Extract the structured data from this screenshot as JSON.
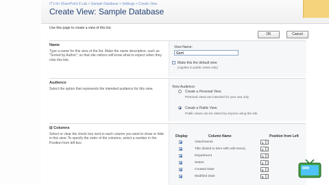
{
  "header": {
    "breadcrumb": "IT's for SharePoint 3 Lab > Sample Database > Settings > Create View",
    "title": "Create View: Sample Database"
  },
  "intro": "Use this page to create a view of this list.",
  "buttons": {
    "ok": "OK",
    "cancel": "Cancel"
  },
  "name_section": {
    "heading": "Name",
    "description": "Type a name for this view of the list. Make the name descriptive, such as \"Sorted by Author\", so that site visitors will know what to expect when they click this link.",
    "field_label": "View Name:",
    "field_value": "Gerri",
    "default_checkbox_label": "Make this the default view",
    "default_checkbox_note": "(Applies to public views only)",
    "default_checked": false
  },
  "audience_section": {
    "heading": "Audience",
    "description": "Select the option that represents the intended audience for this view.",
    "field_label": "View Audience:",
    "options": [
      {
        "label": "Create a Personal View",
        "note": "Personal views are intended for your use only.",
        "selected": false
      },
      {
        "label": "Create a Public View",
        "note": "Public views can be visited by anyone using the site.",
        "selected": true
      }
    ]
  },
  "columns_section": {
    "heading": "⊟ Columns",
    "description": "Select or clear the check box next to each column you want to show or hide in this view. To specify the order of the columns, select a number in the Position from left box.",
    "description_bold": "Position from left",
    "headers": {
      "display": "Display",
      "column_name": "Column Name",
      "position": "Position from Left"
    },
    "rows": [
      {
        "name": "Attachments",
        "checked": true,
        "position": "1"
      },
      {
        "name": "Title (linked to item with edit menu)",
        "checked": true,
        "position": "2"
      },
      {
        "name": "Department",
        "checked": true,
        "position": "3"
      },
      {
        "name": "Status",
        "checked": true,
        "position": "4"
      },
      {
        "name": "Created Date",
        "checked": true,
        "position": "5"
      },
      {
        "name": "Modified Date",
        "checked": true,
        "position": "6"
      }
    ]
  },
  "colors": {
    "title": "#1f3f75",
    "breadcrumb": "#6b8fc9",
    "accent_orange": "#f5d37a"
  },
  "icons": {
    "tv_logo": "tv-logo-icon"
  }
}
